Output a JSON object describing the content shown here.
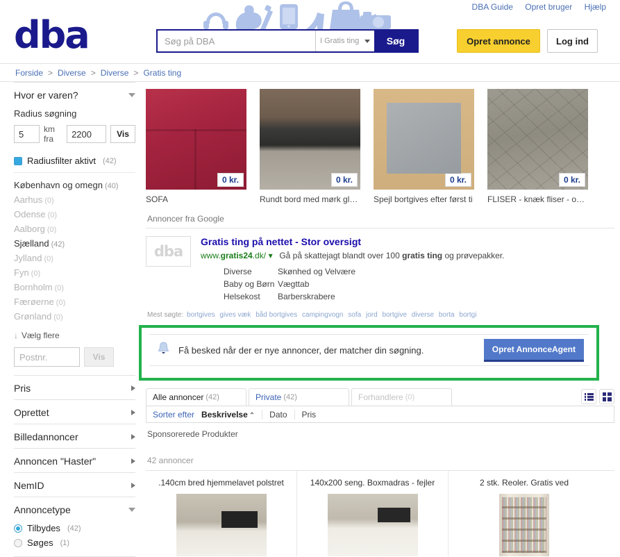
{
  "header": {
    "logo": "dba",
    "toplinks": [
      {
        "label": "DBA Guide"
      },
      {
        "label": "Opret bruger"
      },
      {
        "label": "Hjælp"
      }
    ],
    "search": {
      "placeholder": "Søg på DBA",
      "value": "",
      "category": "I Gratis ting",
      "button": "Søg"
    },
    "create_ad_button": "Opret annonce",
    "login_button": "Log ind"
  },
  "breadcrumb": {
    "sep": ">",
    "items": [
      "Forside",
      "Diverse",
      "Diverse",
      "Gratis ting"
    ]
  },
  "sidebar": {
    "location": {
      "title": "Hvor er varen?",
      "radius_label": "Radius søgning",
      "radius_km": "5",
      "km_fra": "km fra",
      "postal": "2200",
      "show_button": "Vis",
      "radius_filter_label": "Radiusfilter aktivt",
      "radius_filter_count": "(42)",
      "places": [
        {
          "label": "København og omegn",
          "count": "(40)",
          "zero": false
        },
        {
          "label": "Aarhus",
          "count": "(0)",
          "zero": true
        },
        {
          "label": "Odense",
          "count": "(0)",
          "zero": true
        },
        {
          "label": "Aalborg",
          "count": "(0)",
          "zero": true
        },
        {
          "label": "Sjælland",
          "count": "(42)",
          "zero": false
        },
        {
          "label": "Jylland",
          "count": "(0)",
          "zero": true
        },
        {
          "label": "Fyn",
          "count": "(0)",
          "zero": true
        },
        {
          "label": "Bornholm",
          "count": "(0)",
          "zero": true
        },
        {
          "label": "Færøerne",
          "count": "(0)",
          "zero": true
        },
        {
          "label": "Grønland",
          "count": "(0)",
          "zero": true
        }
      ],
      "more_label": "Vælg flere",
      "postnr_placeholder": "Postnr.",
      "postnr_button": "Vis"
    },
    "sections": [
      {
        "label": "Pris"
      },
      {
        "label": "Oprettet"
      },
      {
        "label": "Billedannoncer"
      },
      {
        "label": "Annoncen \"Haster\""
      },
      {
        "label": "NemID"
      }
    ],
    "ad_type": {
      "title": "Annoncetype",
      "options": [
        {
          "label": "Tilbydes",
          "count": "(42)",
          "selected": true
        },
        {
          "label": "Søges",
          "count": "(1)",
          "selected": false
        }
      ]
    }
  },
  "top_cards": [
    {
      "title": "SOFA",
      "price": "0 kr.",
      "photo": "ph-sofa"
    },
    {
      "title": "Rundt bord med mørk glas...",
      "price": "0 kr.",
      "photo": "ph-table"
    },
    {
      "title": "Spejl bortgives efter først ti",
      "price": "0 kr.",
      "photo": "ph-mirror"
    },
    {
      "title": "FLISER - knæk fliser - omk...",
      "price": "0 kr.",
      "photo": "ph-tiles"
    }
  ],
  "google_ads": {
    "label": "Annoncer fra Google",
    "logo_text": "dba",
    "title": "Gratis ting på nettet - Stor oversigt",
    "url_pre": "www.",
    "url_bold": "gratis24",
    "url_post": ".dk/",
    "url_caret": "▾",
    "desc_pre": "Gå på skattejagt blandt over 100 ",
    "desc_bold": "gratis ting",
    "desc_post": " og prøvepakker.",
    "links_col1": [
      "Diverse",
      "Baby og Børn",
      "Helsekost"
    ],
    "links_col2": [
      "Skønhed og Velvære",
      "Vægttab",
      "Barberskrabere"
    ]
  },
  "most_searched": {
    "label": "Mest søgte:",
    "terms": [
      "bortgives",
      "gives væk",
      "båd bortgives",
      "campingvogn",
      "sofa",
      "jord",
      "bortgive",
      "diverse",
      "borta",
      "bortgi"
    ]
  },
  "agent_box": {
    "icon": "bell-icon",
    "text": "Få besked når der er nye annoncer, der matcher din søgning.",
    "button": "Opret AnnonceAgent"
  },
  "tabs": [
    {
      "label": "Alle annoncer",
      "count": "(42)",
      "state": "active"
    },
    {
      "label": "Private",
      "count": "(42)",
      "state": "link"
    },
    {
      "label": "Forhandlere",
      "count": "(0)",
      "state": "disabled"
    }
  ],
  "view_toggle": {
    "list_icon": "list-view-icon",
    "grid_icon": "grid-view-icon"
  },
  "sort": {
    "label": "Sorter efter",
    "active": "Beskrivelse",
    "active_caret": "⌃",
    "options": [
      "Dato",
      "Pris"
    ]
  },
  "sponsored_label": "Sponsorerede Produkter",
  "results_count": "42 annoncer",
  "sponsored_items": [
    {
      "title": ".140cm bred hjemmelavet polstret",
      "photo": "ph-bed1",
      "tall": false
    },
    {
      "title": "140x200 seng. Boxmadras - fejler",
      "photo": "ph-bed2",
      "tall": false
    },
    {
      "title": "2 stk. Reoler. Gratis ved",
      "photo": "ph-shelf",
      "tall": true
    }
  ],
  "colors": {
    "brand_blue": "#1a1a8c",
    "accent_yellow": "#f7cf2e",
    "highlight_green": "#22b24c",
    "agent_button_blue": "#5279c9",
    "link_blue": "#4a6fb5",
    "checkbox_blue": "#35a8e0"
  }
}
